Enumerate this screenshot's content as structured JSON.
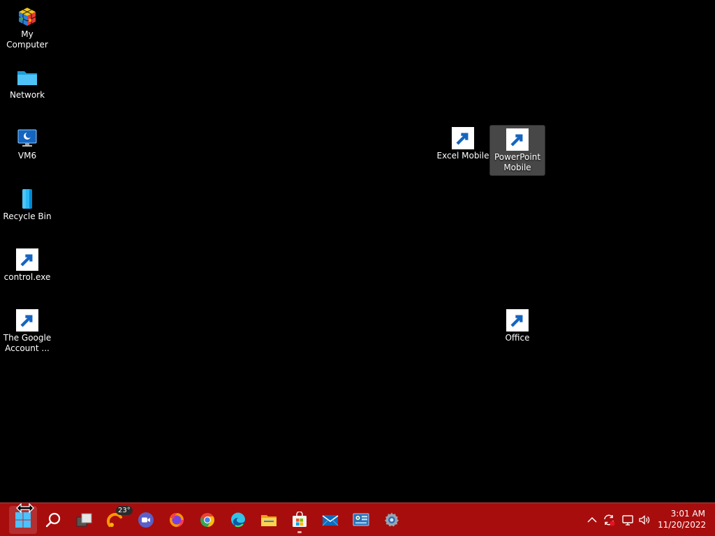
{
  "desktop": {
    "icons": [
      {
        "label": "My Computer",
        "icon": "rubiks-cube-icon"
      },
      {
        "label": "Network",
        "icon": "folder-icon"
      },
      {
        "label": "VM6",
        "icon": "monitor-moon-icon"
      },
      {
        "label": "Recycle Bin",
        "icon": "recycle-bin-icon"
      },
      {
        "label": "control.exe",
        "icon": "control-panel-icon"
      },
      {
        "label": "The Google Account ...",
        "icon": "document-icon"
      },
      {
        "label": "Excel Mobile",
        "icon": "excel-icon"
      },
      {
        "label": "PowerPoint Mobile",
        "icon": "powerpoint-icon",
        "selected": true
      },
      {
        "label": "Office",
        "icon": "office-icon"
      }
    ]
  },
  "taskbar": {
    "background": "#a80d0d",
    "weather_badge": "23°",
    "apps": [
      {
        "name": "start",
        "icon": "windows-start-icon"
      },
      {
        "name": "search",
        "icon": "search-icon"
      },
      {
        "name": "task-view",
        "icon": "task-view-icon"
      },
      {
        "name": "weather",
        "icon": "weather-sun-icon"
      },
      {
        "name": "meet",
        "icon": "video-call-icon"
      },
      {
        "name": "firefox",
        "icon": "firefox-icon"
      },
      {
        "name": "chrome",
        "icon": "chrome-icon"
      },
      {
        "name": "edge",
        "icon": "edge-icon"
      },
      {
        "name": "file-explorer",
        "icon": "file-explorer-icon"
      },
      {
        "name": "store",
        "icon": "store-icon",
        "running": true
      },
      {
        "name": "mail",
        "icon": "mail-icon"
      },
      {
        "name": "control-panel",
        "icon": "control-panel-icon"
      },
      {
        "name": "settings",
        "icon": "gear-icon"
      }
    ],
    "tray": {
      "chevron": "chevron-up-icon",
      "sync": "sync-icon",
      "network": "network-icon",
      "volume": "speaker-icon"
    },
    "clock": {
      "time": "3:01 AM",
      "date": "11/20/2022"
    }
  }
}
